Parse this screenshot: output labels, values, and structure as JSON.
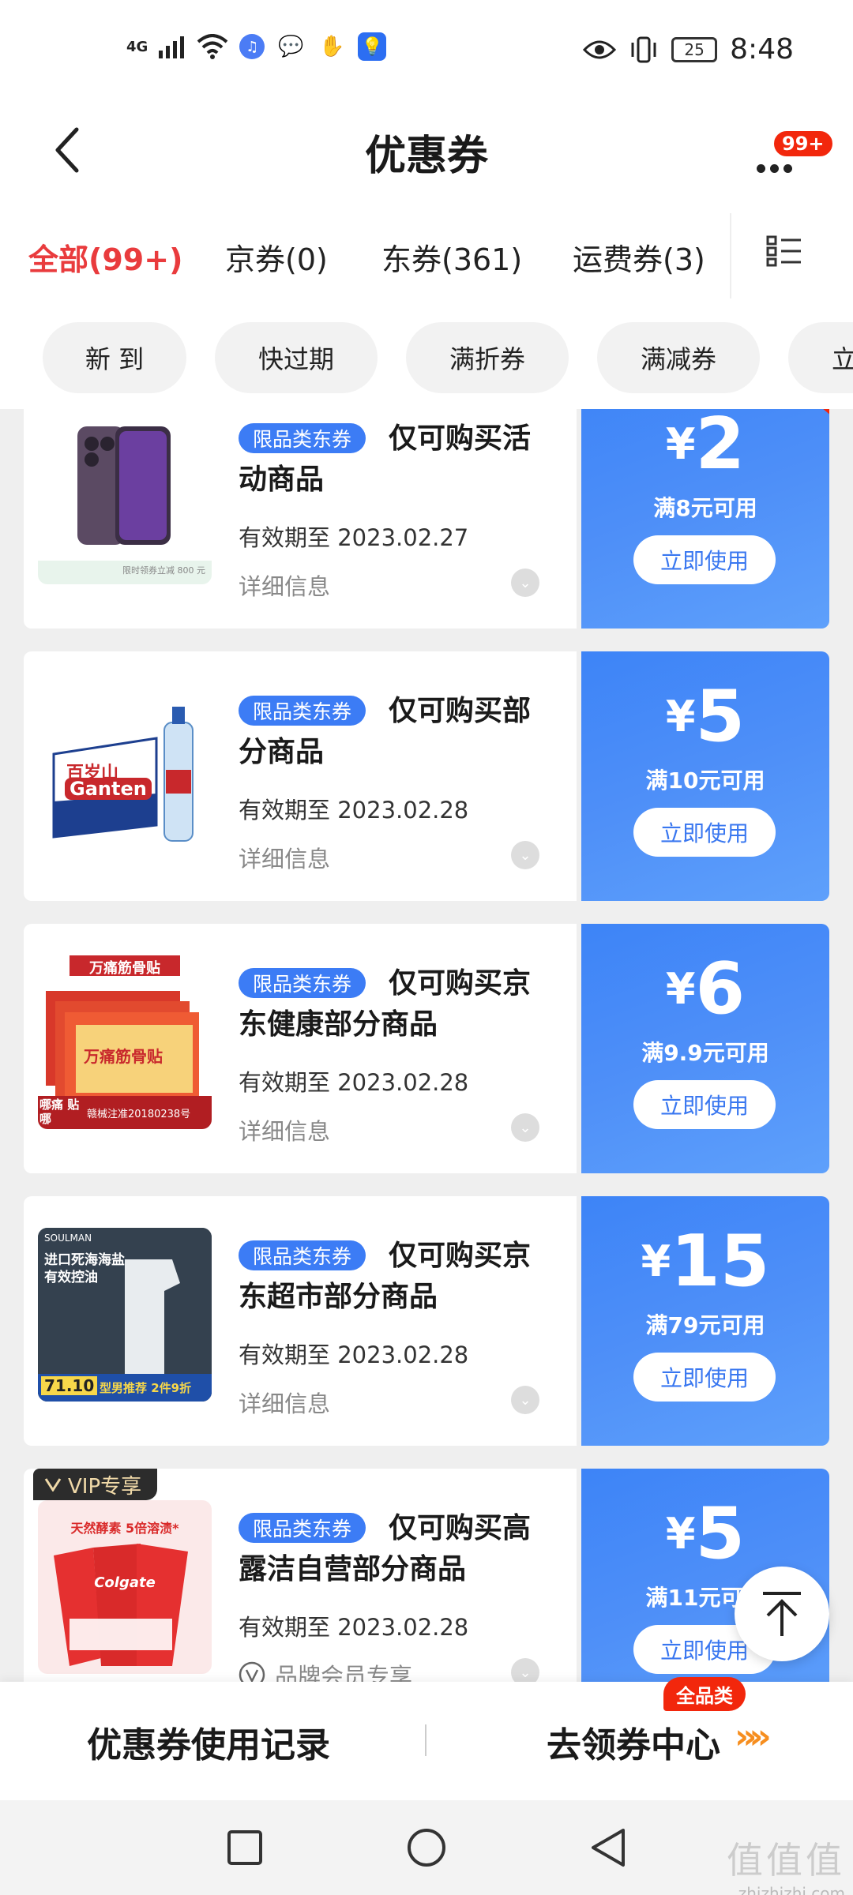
{
  "status_bar": {
    "network": "4G",
    "battery": "25",
    "time": "8:48"
  },
  "header": {
    "title": "优惠券",
    "badge": "99+"
  },
  "tabs": [
    {
      "label": "全部(99+)",
      "active": true
    },
    {
      "label": "京券(0)"
    },
    {
      "label": "东券(361)"
    },
    {
      "label": "运费券(3)"
    }
  ],
  "filters": [
    "新 到",
    "快过期",
    "满折券",
    "满减券",
    "立"
  ],
  "coupons": [
    {
      "badge": "限品类东券",
      "title": "仅可购买活动商品",
      "expiry": "有效期至 2023.02.27",
      "detail": "详细信息",
      "yen": "¥",
      "amount": "2",
      "condition": "满8元可用",
      "button": "立即使用"
    },
    {
      "badge": "限品类东券",
      "title": "仅可购买部分商品",
      "expiry": "有效期至 2023.02.28",
      "detail": "详细信息",
      "yen": "¥",
      "amount": "5",
      "condition": "满10元可用",
      "button": "立即使用"
    },
    {
      "badge": "限品类东券",
      "title": "仅可购买京东健康部分商品",
      "expiry": "有效期至 2023.02.28",
      "detail": "详细信息",
      "yen": "¥",
      "amount": "6",
      "condition": "满9.9元可用",
      "button": "立即使用"
    },
    {
      "badge": "限品类东券",
      "title": "仅可购买京东超市部分商品",
      "expiry": "有效期至 2023.02.28",
      "detail": "详细信息",
      "yen": "¥",
      "amount": "15",
      "condition": "满79元可用",
      "button": "立即使用"
    },
    {
      "badge": "限品类东券",
      "title": "仅可购买高露洁自营部分商品",
      "expiry": "有效期至 2023.02.28",
      "detail": "品牌会员专享",
      "yen": "¥",
      "amount": "5",
      "condition": "满11元可用",
      "button": "立即使用",
      "vip": "VIP专享"
    }
  ],
  "thumbs": {
    "phone_caption": "限时领券立减 800 元",
    "water_brand": "百岁山",
    "water_brand_en": "Ganten",
    "plaster_top": "万痛筋骨贴",
    "plaster_name": "万痛筋骨贴",
    "plaster_side": "哪痛 贴哪",
    "plaster_reg": "赣械注准20180238号",
    "salt_brand": "SOULMAN",
    "salt_line1": "进口死海海盐",
    "salt_line2": "有效控油",
    "salt_price": "71.10",
    "salt_promo": "型男推荐  2件9折",
    "tp_line": "天然酵素 5倍溶渍*",
    "tp_brand": "Colgate"
  },
  "bottom": {
    "history": "优惠券使用记录",
    "center": "去领券中心",
    "arrows": "»»",
    "tag": "全品类"
  },
  "watermark": {
    "big": "值值值",
    "small": "zhizhizhi.com"
  }
}
